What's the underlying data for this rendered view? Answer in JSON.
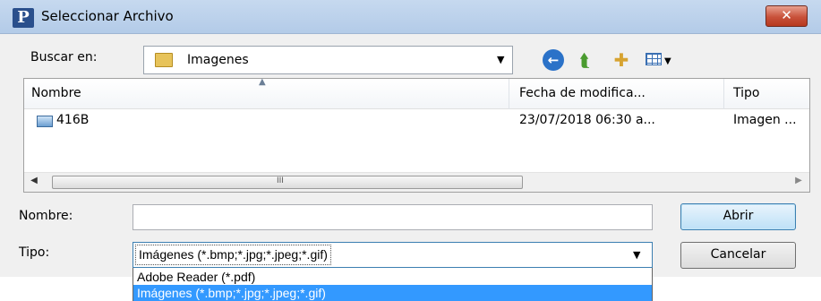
{
  "window": {
    "title": "Seleccionar Archivo",
    "app_icon_letter": "P",
    "close_glyph": "✕"
  },
  "toolbar": {
    "look_in_label": "Buscar en:",
    "look_in_value": "Imagenes",
    "icons": [
      "back-icon",
      "up-folder-icon",
      "new-folder-icon",
      "views-menu-icon"
    ]
  },
  "file_list": {
    "columns": [
      "Nombre",
      "Fecha de modifica...",
      "Tipo"
    ],
    "rows": [
      {
        "name": "416B",
        "date": "23/07/2018 06:30 a...",
        "type": "Imagen ..."
      }
    ],
    "scroll_grip": "III"
  },
  "form": {
    "filename_label": "Nombre:",
    "filename_value": "",
    "type_label": "Tipo:",
    "type_value": "Imágenes (*.bmp;*.jpg;*.jpeg;*.gif)",
    "type_options": [
      "Adobe Reader (*.pdf)",
      "Imágenes (*.bmp;*.jpg;*.jpeg;*.gif)"
    ],
    "selected_option_index": 1,
    "open_label": "Abrir",
    "cancel_label": "Cancelar"
  },
  "colors": {
    "highlight": "#3399ff",
    "title_bar": "#c6d9ef",
    "close_button": "#c8513a"
  }
}
